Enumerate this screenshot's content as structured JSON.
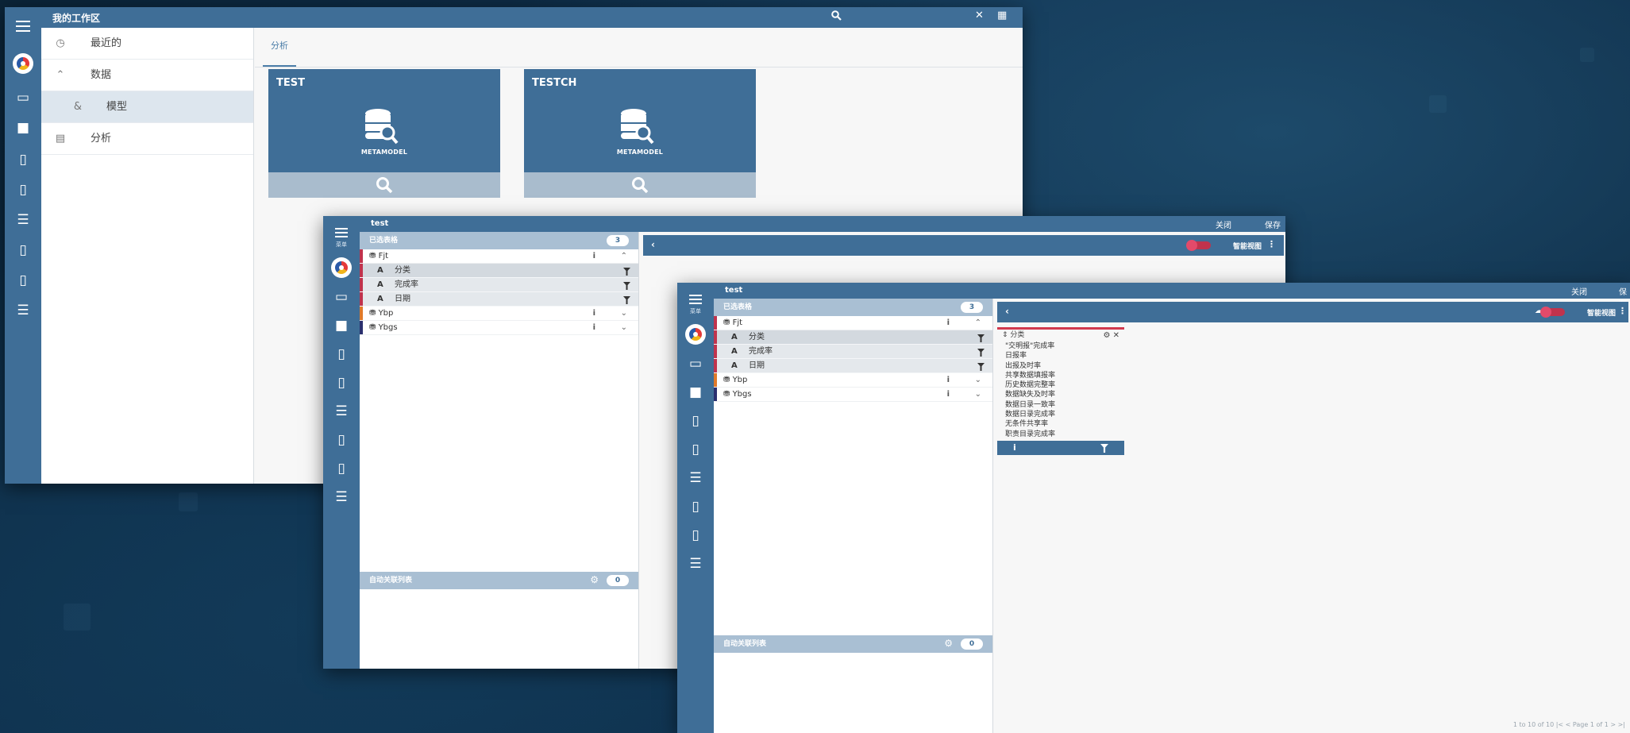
{
  "colors": {
    "primary": "#3f6e97",
    "accent": "#c0334d",
    "card_footer": "#a9bccd"
  },
  "workspace": {
    "title": "我的工作区",
    "nav": [
      {
        "icon": "clock-icon",
        "label": "最近的"
      },
      {
        "icon": "chevron-up-icon",
        "label": "数据"
      },
      {
        "icon": "model-icon",
        "label": "模型"
      },
      {
        "icon": "calculator-icon",
        "label": "分析"
      }
    ],
    "tab": "分析",
    "cards": [
      {
        "name": "TEST",
        "caption": "METAMODEL"
      },
      {
        "name": "TESTCH",
        "caption": "METAMODEL"
      }
    ]
  },
  "editor": {
    "title": "test",
    "close_label": "关闭",
    "save_label": "保存",
    "menu_label": "菜单",
    "selected_tables_label": "已选表格",
    "selected_count": "3",
    "tables": [
      {
        "name": "Fjt",
        "marker_color": "#c0334d",
        "expanded": true,
        "fields": [
          "分类",
          "完成率",
          "日期"
        ]
      },
      {
        "name": "Ybp",
        "marker_color": "#e07a2a",
        "expanded": false,
        "fields": []
      },
      {
        "name": "Ybgs",
        "marker_color": "#2a2f6e",
        "expanded": false,
        "fields": []
      }
    ],
    "auto_relations_label": "自动关联列表",
    "auto_count": "0",
    "view_label": "智能视图",
    "filter": {
      "field": "分类",
      "options": [
        "\"交明报\"完成率",
        "日报率",
        "出报及时率",
        "共享数据填报率",
        "历史数据完整率",
        "数据缺失及时率",
        "数据日录一致率",
        "数据日录完成率",
        "无条件共享率",
        "职责目录完成率"
      ]
    },
    "pager": "1 to 10 of 10    |<  <  Page 1 of 1  >  >|"
  }
}
